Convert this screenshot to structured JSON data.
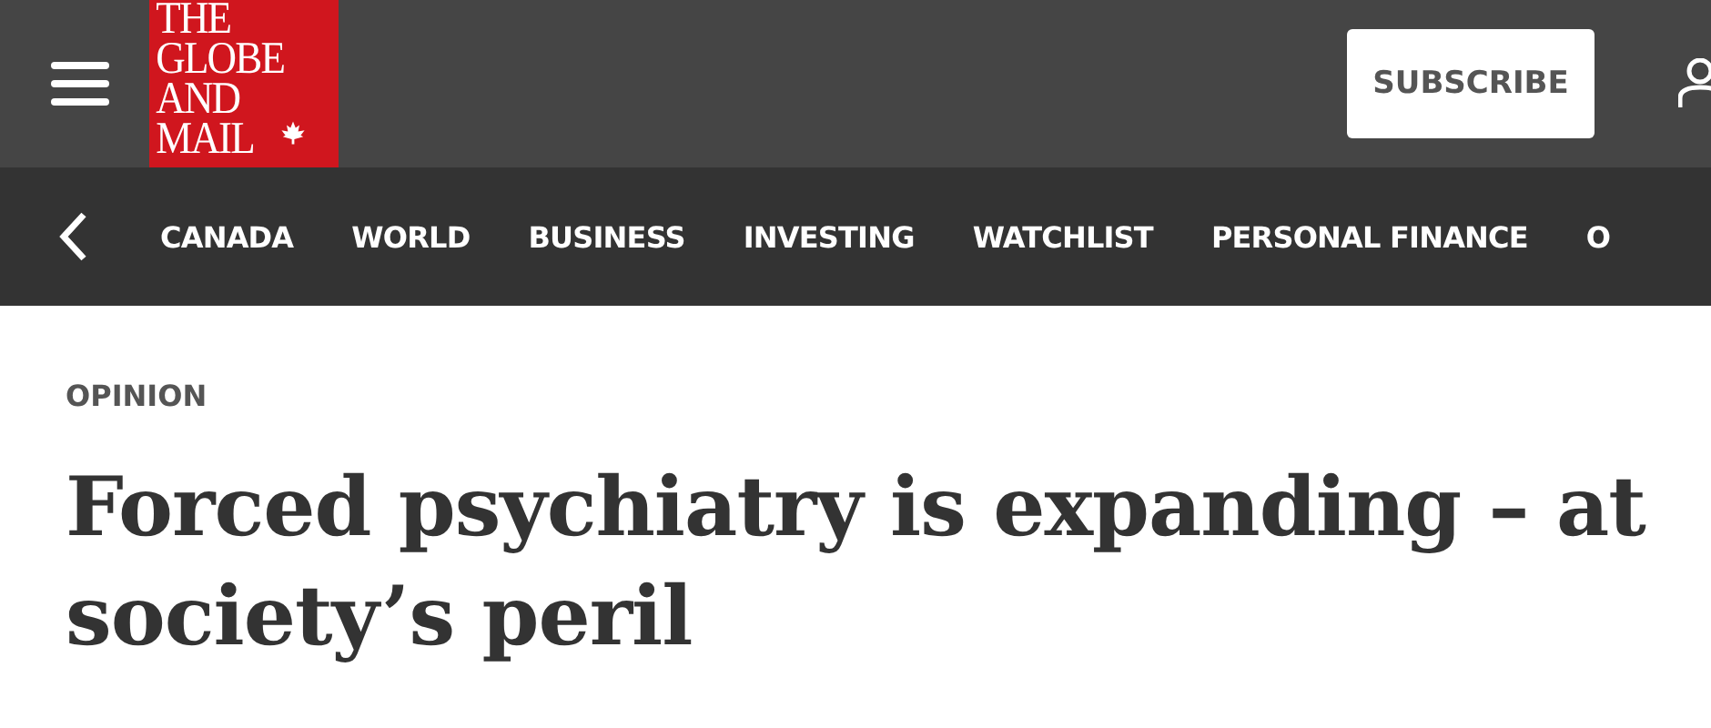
{
  "header": {
    "logo_lines": [
      "THE",
      "GLOBE",
      "AND",
      "MAIL"
    ],
    "subscribe_button": "SUBSCRIBE"
  },
  "nav": {
    "items": [
      {
        "label": "CANADA"
      },
      {
        "label": "WORLD"
      },
      {
        "label": "BUSINESS"
      },
      {
        "label": "INVESTING"
      },
      {
        "label": "WATCHLIST"
      },
      {
        "label": "PERSONAL FINANCE"
      },
      {
        "label": "O"
      }
    ]
  },
  "article": {
    "section": "OPINION",
    "headline_lines": [
      "Forced psychiatry is expanding – at",
      "society’s peril"
    ]
  }
}
